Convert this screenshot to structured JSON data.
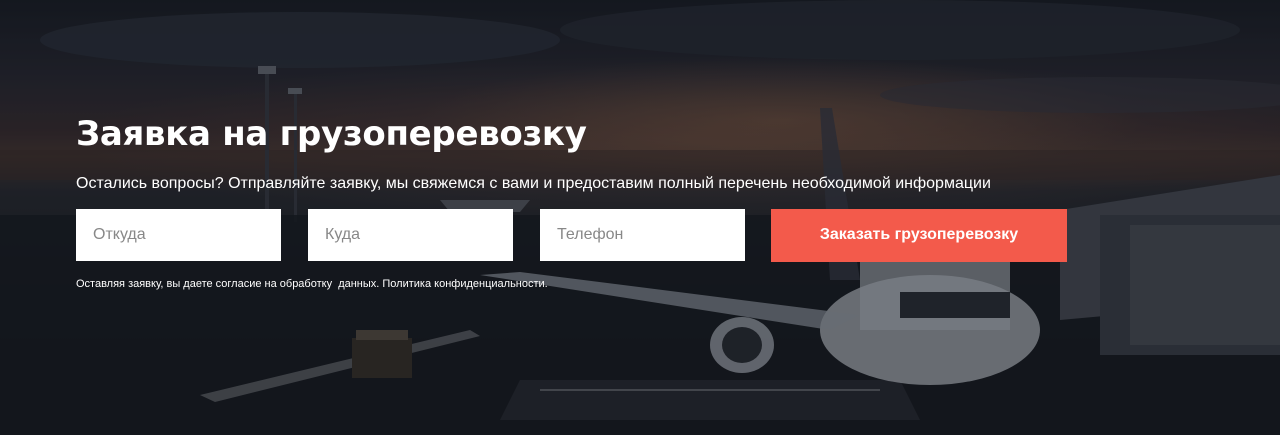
{
  "section": {
    "title": "Заявка на грузоперевозку",
    "subtitle": "Остались вопросы? Отправляйте заявку, мы свяжемся с вами и предоставим полный перечень необходимой информации"
  },
  "form": {
    "from_placeholder": "Откуда",
    "to_placeholder": "Куда",
    "phone_placeholder": "Телефон",
    "submit_label": "Заказать грузоперевозку",
    "consent_text": "Оставляя заявку, вы даете согласие на обработку  данных. Политика конфиденциальности."
  },
  "colors": {
    "accent": "#f35a4b",
    "text": "#ffffff"
  }
}
